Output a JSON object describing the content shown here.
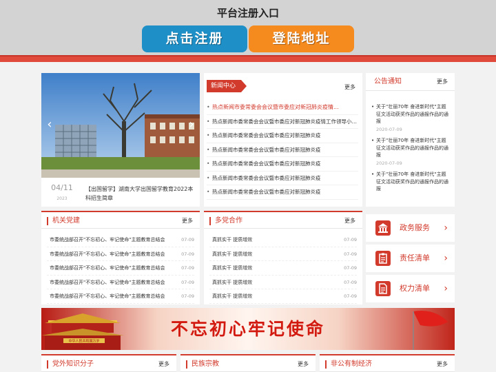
{
  "overlay": {
    "title": "平台注册入口",
    "register_label": "点击注册",
    "login_label": "登陆地址"
  },
  "slider": {
    "date_day": "04/11",
    "date_year": "2023",
    "caption": "【出国留学】湖南大学出国留学教育2022本科招生简章"
  },
  "news": {
    "title": "新闻中心",
    "more": "更多",
    "items": [
      "热点新闻市委常委会会议暨市委应对新冠肺炎疫情...",
      "热点新闻市委常委会会议暨市委应对新冠肺炎疫情工作领导小组会议",
      "热点新闻市委常委会会议暨市委应对新冠肺炎疫",
      "热点新闻市委常委会会议暨市委应对新冠肺炎疫",
      "热点新闻市委常委会会议暨市委应对新冠肺炎疫",
      "热点新闻市委常委会会议暨市委应对新冠肺炎疫",
      "热点新闻市委常委会会议暨市委应对新冠肺炎疫"
    ]
  },
  "notice": {
    "title": "公告通知",
    "more": "更多",
    "items": [
      {
        "text": "关于\"壮丽70年 奋进新时代\"主题征文活动获奖作品的通报作品的通报",
        "date": "2020-07-09"
      },
      {
        "text": "关于\"壮丽70年 奋进新时代\"主题征文活动获奖作品的通报作品的通报",
        "date": "2020-07-09"
      },
      {
        "text": "关于\"壮丽70年 奋进新时代\"主题征文活动获奖作品的通报作品的通报",
        "date": ""
      }
    ]
  },
  "party": {
    "title": "机关党建",
    "more": "更多",
    "items": [
      {
        "text": "市委统战部召开\"不忘初心、牢记使命\"主题教育总结会",
        "date": "07-09"
      },
      {
        "text": "市委统战部召开\"不忘初心、牢记使命\"主题教育总结会",
        "date": "07-09"
      },
      {
        "text": "市委统战部召开\"不忘初心、牢记使命\"主题教育总结会",
        "date": "07-09"
      },
      {
        "text": "市委统战部召开\"不忘初心、牢记使命\"主题教育总结会",
        "date": "07-09"
      },
      {
        "text": "市委统战部召开\"不忘初心、牢记使命\"主题教育总结会",
        "date": "07-09"
      }
    ]
  },
  "coop": {
    "title": "多党合作",
    "more": "更多",
    "items": [
      {
        "text": "真抓实干 提质增效",
        "date": "07-09"
      },
      {
        "text": "真抓实干 提质增效",
        "date": "07-09"
      },
      {
        "text": "真抓实干 提质增效",
        "date": "07-09"
      },
      {
        "text": "真抓实干 提质增效",
        "date": "07-09"
      },
      {
        "text": "真抓实干 提质增效",
        "date": "07-09"
      }
    ]
  },
  "services": [
    {
      "label": "政务服务",
      "icon": "bank-icon"
    },
    {
      "label": "责任清单",
      "icon": "clipboard-icon"
    },
    {
      "label": "权力清单",
      "icon": "document-icon"
    }
  ],
  "banner": {
    "text": "不忘初心牢记使命",
    "caption": "中华人民共和国万岁"
  },
  "bottom": [
    {
      "title": "党外知识分子",
      "more": "更多"
    },
    {
      "title": "民族宗教",
      "more": "更多"
    },
    {
      "title": "非公有制经济",
      "more": "更多"
    }
  ],
  "colors": {
    "accent": "#d23a2c",
    "register": "#1e8fc7",
    "login": "#f58a1f"
  }
}
